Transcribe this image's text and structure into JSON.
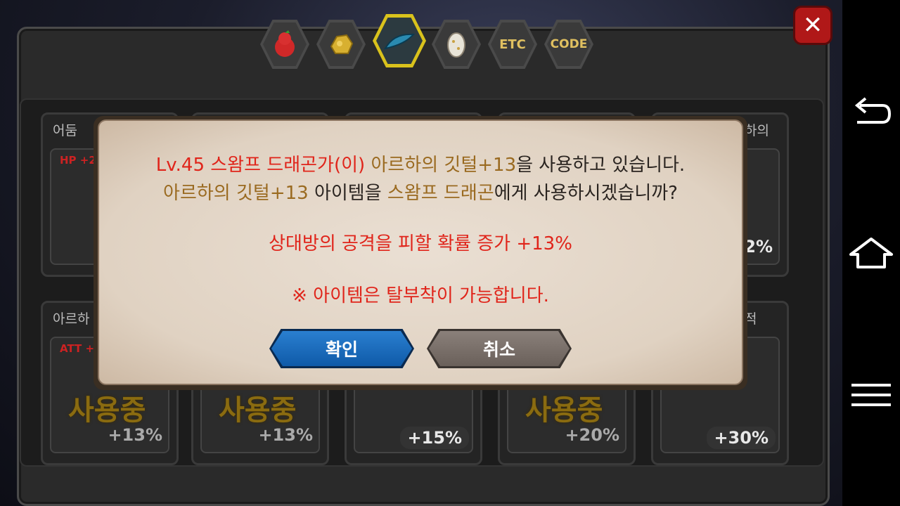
{
  "tabs": [
    {
      "name": "fruit-tab",
      "label": ""
    },
    {
      "name": "gold-ore-tab",
      "label": ""
    },
    {
      "name": "feather-tab",
      "label": ""
    },
    {
      "name": "egg-tab",
      "label": ""
    },
    {
      "name": "etc-tab",
      "label": "ETC"
    },
    {
      "name": "code-tab",
      "label": "CODE"
    }
  ],
  "cards": [
    {
      "title": "어둠",
      "stat": "HP +2",
      "pct": "",
      "using": ""
    },
    {
      "title": "",
      "stat": "",
      "pct": "",
      "using": ""
    },
    {
      "title": "",
      "stat": "",
      "pct": "",
      "using": ""
    },
    {
      "title": "",
      "stat": "",
      "pct": "",
      "using": ""
    },
    {
      "title": "하의",
      "stat": "",
      "pct": "12%",
      "using": ""
    },
    {
      "title": "아르하",
      "stat": "ATT +",
      "pct": "+13%",
      "using": "사용중"
    },
    {
      "title": "",
      "stat": "",
      "pct": "+13%",
      "using": "사용중"
    },
    {
      "title": "",
      "stat": "",
      "pct": "+15%",
      "using": ""
    },
    {
      "title": "",
      "stat": "",
      "pct": "+20%",
      "using": "사용중"
    },
    {
      "title": "적",
      "stat": "",
      "pct": "+30%",
      "using": ""
    }
  ],
  "dialog": {
    "line1": {
      "level": "Lv.45 스왐프 드래곤가(이)",
      "item": "아르하의 깃털+13",
      "rest": "을 사용하고 있습니다."
    },
    "line2": {
      "item": "아르하의 깃털+13",
      "mid": "아이템을",
      "target": "스왐프 드래곤",
      "rest": "에게 사용하시겠습니까?"
    },
    "effect": "상대방의 공격을 피할 확률 증가 +13%",
    "note": "※ 아이템은 탈부착이 가능합니다.",
    "confirm_label": "확인",
    "cancel_label": "취소"
  },
  "close_icon": "close-icon",
  "nav": {
    "back": "back-icon",
    "home": "home-icon",
    "menu": "menu-icon"
  },
  "colors": {
    "accent_red": "#e0241a",
    "item_brown": "#9a6a20",
    "confirm_blue": "#1a6cc0",
    "using_gold": "#8a6b10"
  }
}
